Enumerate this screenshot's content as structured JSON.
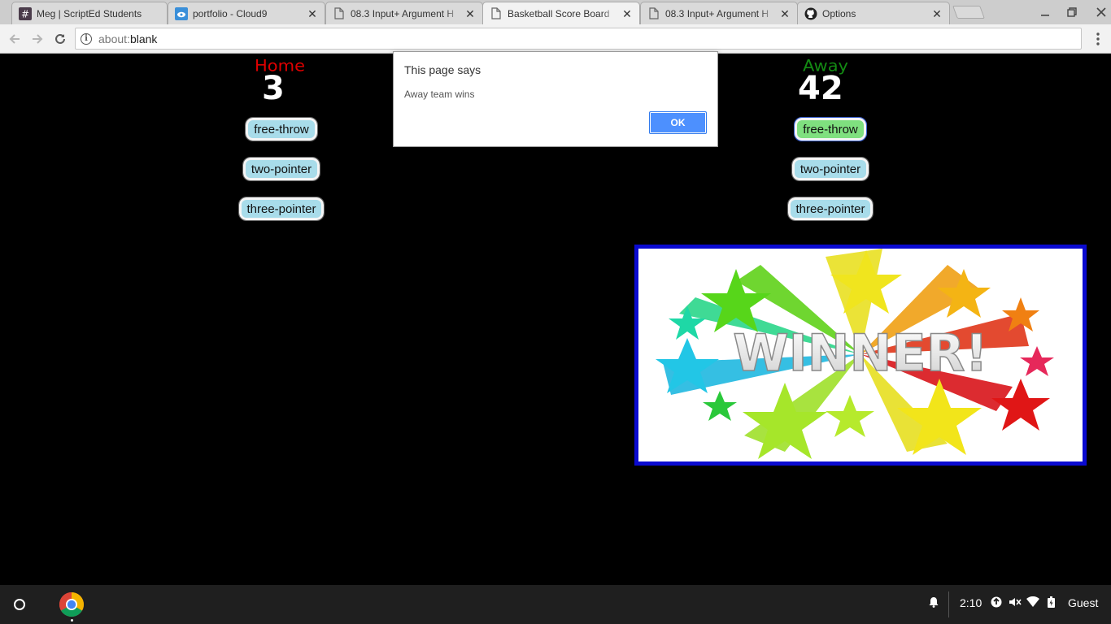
{
  "browser": {
    "tabs": [
      {
        "title": "Meg | ScriptEd Students",
        "icon": "slack-hash-icon",
        "active": false
      },
      {
        "title": "portfolio - Cloud9",
        "icon": "cloud9-icon",
        "active": false
      },
      {
        "title": "08.3 Input+ Argument H",
        "icon": "document-icon",
        "active": false
      },
      {
        "title": "Basketball Score Board",
        "icon": "document-icon",
        "active": true
      },
      {
        "title": "08.3 Input+ Argument H",
        "icon": "document-icon",
        "active": false
      },
      {
        "title": "Options",
        "icon": "github-icon",
        "active": false
      }
    ],
    "address": {
      "scheme": "about:",
      "host": "blank"
    }
  },
  "scoreboard": {
    "home": {
      "label": "Home",
      "score": "3",
      "color": "#e00000"
    },
    "away": {
      "label": "Away",
      "score": "42",
      "color": "#138a13"
    },
    "buttons": {
      "free_throw": "free-throw",
      "two_pointer": "two-pointer",
      "three_pointer": "three-pointer"
    },
    "winner_image_text": "WINNER!"
  },
  "dialog": {
    "title": "This page says",
    "message": "Away team wins",
    "ok_label": "OK"
  },
  "shelf": {
    "time": "2:10",
    "user": "Guest"
  },
  "colors": {
    "button_bg": "#a8dcea",
    "focused_button_bg": "#7fe07f",
    "frame_border": "#0a0ad0"
  }
}
